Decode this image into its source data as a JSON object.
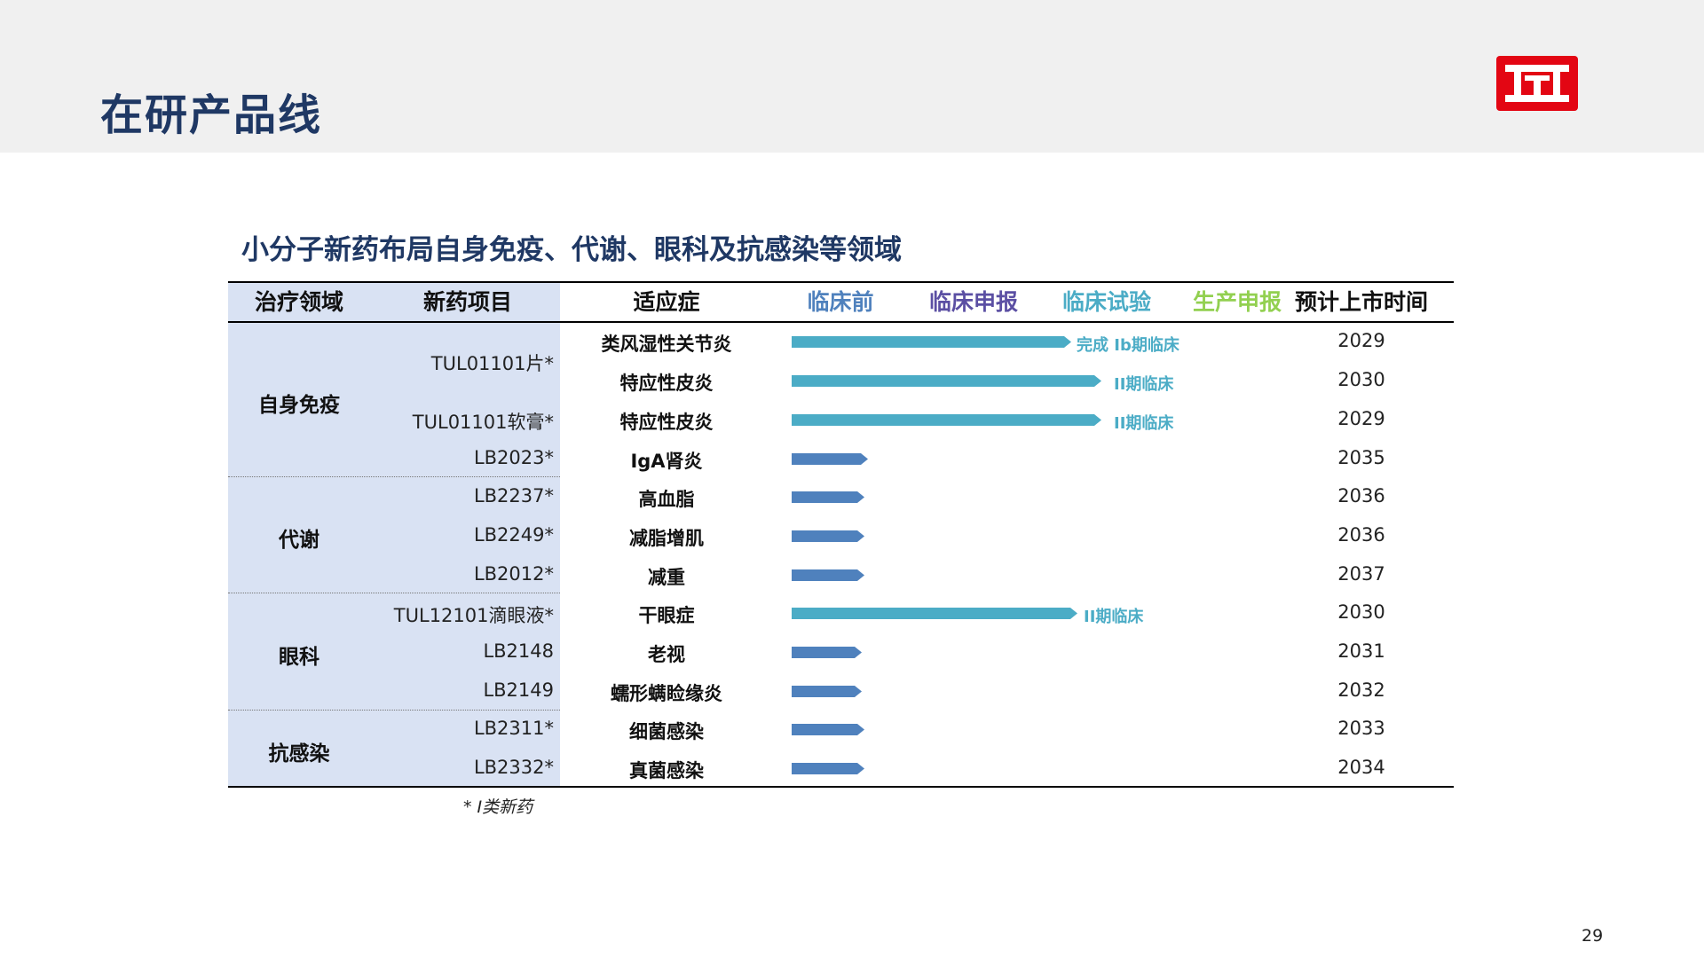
{
  "page": {
    "title": "在研产品线",
    "subtitle": "小分子新药布局自身免疫、代谢、眼科及抗感染等领域",
    "footnote": "* I类新药",
    "page_number": "29",
    "logo_icon": "company-logo-icon",
    "colors": {
      "title": "#1f3864",
      "logo_bg": "#e30613",
      "bar_teal": "#4bacc6",
      "bar_blue": "#4f81bd",
      "left_column_bg": "#d9e2f3"
    }
  },
  "table": {
    "headers": {
      "area": "治疗领域",
      "project": "新药项目",
      "indication": "适应症",
      "stage1": "临床前",
      "stage2": "临床申报",
      "stage3": "临床试验",
      "stage4": "生产申报",
      "launch": "预计上市时间"
    },
    "stage_colors": [
      "#4f81bd",
      "#5b4fa3",
      "#4bacc6",
      "#92d050"
    ],
    "areas": [
      "自身免疫",
      "代谢",
      "眼科",
      "抗感染"
    ],
    "projects": [
      "TUL01101片*",
      "TUL01101软膏*",
      "LB2023*",
      "LB2237*",
      "LB2249*",
      "LB2012*",
      "TUL12101滴眼液*",
      "LB2148",
      "LB2149",
      "LB2311*",
      "LB2332*"
    ],
    "rows": [
      {
        "indication": "类风湿性关节炎",
        "progress_stages": 2.3,
        "color": "#4bacc6",
        "label": "完成 Ib期临床",
        "year": "2029"
      },
      {
        "indication": "特应性皮炎",
        "progress_stages": 2.55,
        "color": "#4bacc6",
        "label": "II期临床",
        "year": "2030"
      },
      {
        "indication": "特应性皮炎",
        "progress_stages": 2.55,
        "color": "#4bacc6",
        "label": "II期临床",
        "year": "2029"
      },
      {
        "indication": "IgA肾炎",
        "progress_stages": 0.63,
        "color": "#4f81bd",
        "label": "",
        "year": "2035"
      },
      {
        "indication": "高血脂",
        "progress_stages": 0.6,
        "color": "#4f81bd",
        "label": "",
        "year": "2036"
      },
      {
        "indication": "减脂增肌",
        "progress_stages": 0.6,
        "color": "#4f81bd",
        "label": "",
        "year": "2036"
      },
      {
        "indication": "减重",
        "progress_stages": 0.6,
        "color": "#4f81bd",
        "label": "",
        "year": "2037"
      },
      {
        "indication": "干眼症",
        "progress_stages": 2.35,
        "color": "#4bacc6",
        "label": "II期临床",
        "year": "2030"
      },
      {
        "indication": "老视",
        "progress_stages": 0.58,
        "color": "#4f81bd",
        "label": "",
        "year": "2031"
      },
      {
        "indication": "蠕形螨睑缘炎",
        "progress_stages": 0.58,
        "color": "#4f81bd",
        "label": "",
        "year": "2032"
      },
      {
        "indication": "细菌感染",
        "progress_stages": 0.6,
        "color": "#4f81bd",
        "label": "",
        "year": "2033"
      },
      {
        "indication": "真菌感染",
        "progress_stages": 0.6,
        "color": "#4f81bd",
        "label": "",
        "year": "2034"
      }
    ]
  }
}
